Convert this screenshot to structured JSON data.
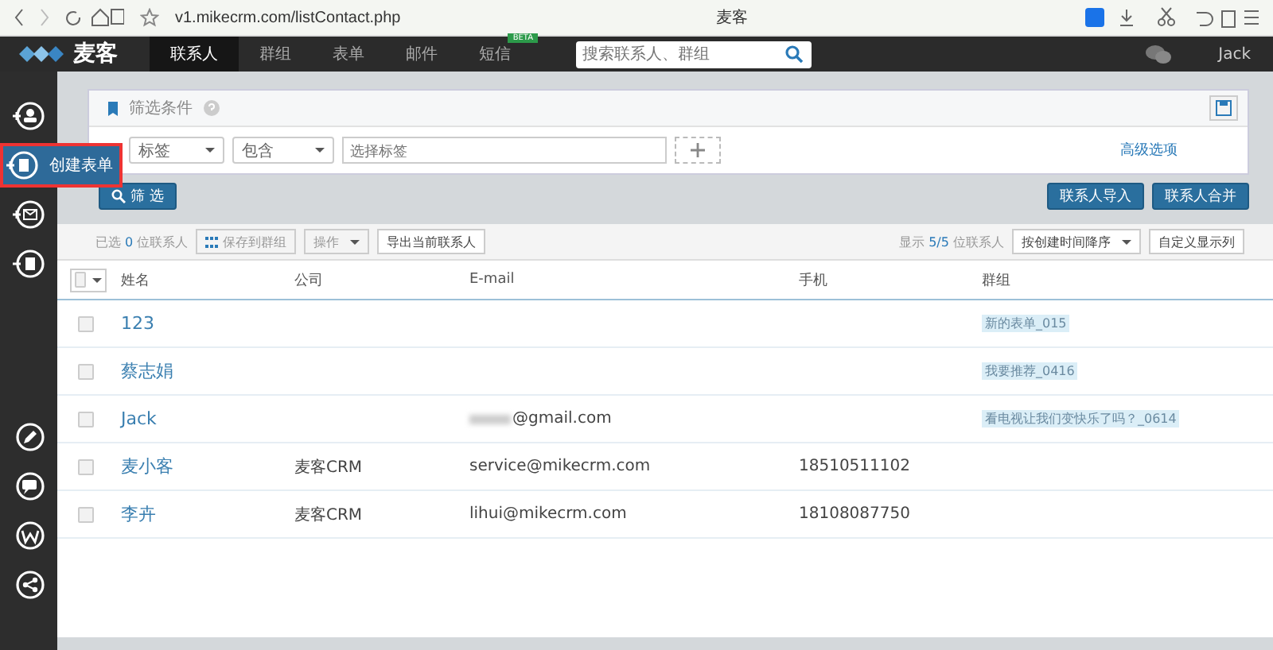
{
  "browser": {
    "url": "v1.mikecrm.com/listContact.php",
    "site_label": "麦客"
  },
  "app_nav": {
    "logo": "麦客",
    "tabs": [
      {
        "label": "联系人",
        "selected": true
      },
      {
        "label": "群组",
        "selected": false
      },
      {
        "label": "表单",
        "selected": false
      },
      {
        "label": "邮件",
        "selected": false
      },
      {
        "label": "短信",
        "selected": false,
        "badge": "BETA"
      }
    ],
    "search": {
      "placeholder": "搜索联系人、群组"
    },
    "user": "Jack"
  },
  "sidebar": {
    "top_items": [
      {
        "hovered": false
      },
      {
        "hovered": true,
        "tooltip": "创建表单"
      },
      {
        "hovered": false
      },
      {
        "hovered": false
      }
    ],
    "bottom_items": [
      {
        "hovered": false
      },
      {
        "hovered": false
      },
      {
        "hovered": false
      },
      {
        "hovered": false
      }
    ]
  },
  "filter": {
    "title": "筛选条件",
    "field": "标签",
    "operator": "包含",
    "value_placeholder": "选择标签",
    "advanced": "高级选项",
    "filter_button": "筛 选"
  },
  "actions": [
    "联系人导入",
    "联系人合并"
  ],
  "toolbar": {
    "selected_prefix": "已选",
    "selected_count": "0",
    "selected_suffix": "位联系人",
    "save_group": "保存到群组",
    "operate": "操作",
    "export": "导出当前联系人",
    "shown_prefix": "显示",
    "shown_count": "5/5",
    "shown_suffix": "位联系人",
    "sort": "按创建时间降序",
    "customize": "自定义显示列"
  },
  "table": {
    "select_all_checked": false,
    "columns": [
      "姓名",
      "公司",
      "E-mail",
      "手机",
      "群组"
    ],
    "rows": [
      {
        "checked": false,
        "name": "123",
        "group": "新的表单_015"
      },
      {
        "checked": false,
        "name": "蔡志娟",
        "group": "我要推荐_0416"
      },
      {
        "checked": false,
        "name": "Jack",
        "email": "@gmail.com",
        "email_redacted": true,
        "group": "看电视让我们变快乐了吗？_0614"
      },
      {
        "checked": false,
        "name": "麦小客",
        "company": "麦客CRM",
        "email": "service@mikecrm.com",
        "phone": "18510511102"
      },
      {
        "checked": false,
        "name": "李卉",
        "company": "麦客CRM",
        "email": "lihui@mikecrm.com",
        "phone": "18108087750"
      }
    ]
  }
}
